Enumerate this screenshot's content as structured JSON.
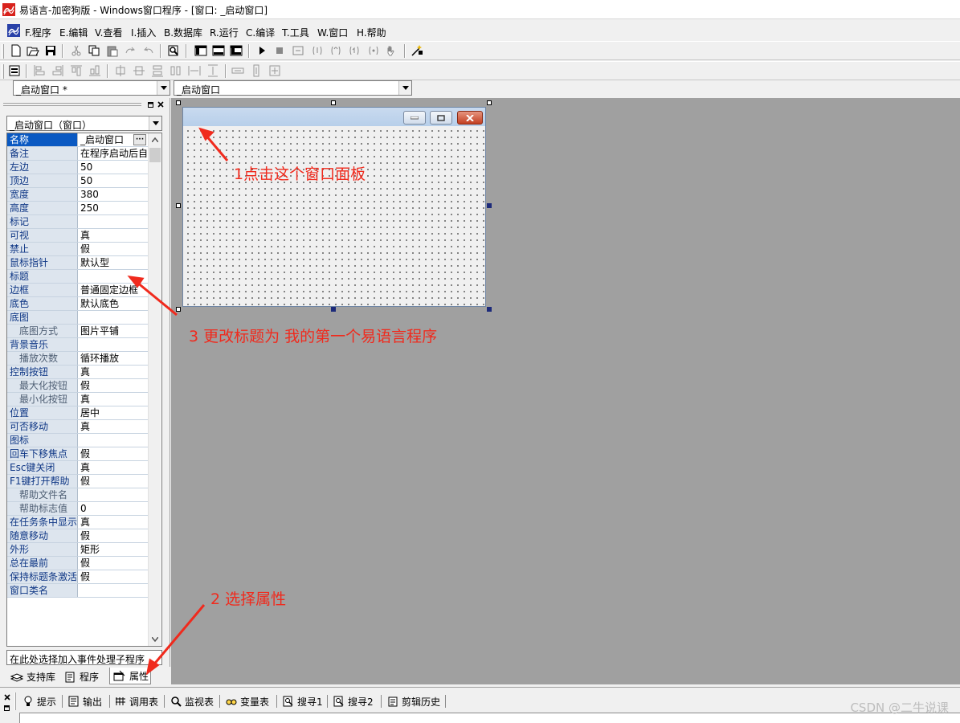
{
  "window_title": "易语言-加密狗版 - Windows窗口程序 - [窗口: _启动窗口]",
  "menu": [
    "F.程序",
    "E.编辑",
    "V.查看",
    "I.插入",
    "B.数据库",
    "R.运行",
    "C.编译",
    "T.工具",
    "W.窗口",
    "H.帮助"
  ],
  "combos": {
    "object_selector": "_启动窗口 *",
    "event_selector": "_启动窗口"
  },
  "panel": {
    "object_combo": "_启动窗口（窗口）",
    "properties": [
      {
        "name": "名称",
        "value": "_启动窗口"
      },
      {
        "name": "备注",
        "value": "在程序启动后自"
      },
      {
        "name": "左边",
        "value": "50"
      },
      {
        "name": "顶边",
        "value": "50"
      },
      {
        "name": "宽度",
        "value": "380"
      },
      {
        "name": "高度",
        "value": "250"
      },
      {
        "name": "标记",
        "value": ""
      },
      {
        "name": "可视",
        "value": "真"
      },
      {
        "name": "禁止",
        "value": "假"
      },
      {
        "name": "鼠标指针",
        "value": "默认型"
      },
      {
        "name": "标题",
        "value": ""
      },
      {
        "name": "边框",
        "value": "普通固定边框"
      },
      {
        "name": "底色",
        "value": "默认底色"
      },
      {
        "name": "底图",
        "value": ""
      },
      {
        "name": "底图方式",
        "value": "图片平铺"
      },
      {
        "name": "背景音乐",
        "value": ""
      },
      {
        "name": "播放次数",
        "value": "循环播放"
      },
      {
        "name": "控制按钮",
        "value": "真"
      },
      {
        "name": "最大化按钮",
        "value": "假"
      },
      {
        "name": "最小化按钮",
        "value": "真"
      },
      {
        "name": "位置",
        "value": "居中"
      },
      {
        "name": "可否移动",
        "value": "真"
      },
      {
        "name": "图标",
        "value": ""
      },
      {
        "name": "回车下移焦点",
        "value": "假"
      },
      {
        "name": "Esc键关闭",
        "value": "真"
      },
      {
        "name": "F1键打开帮助",
        "value": "假"
      },
      {
        "name": "帮助文件名",
        "value": ""
      },
      {
        "name": "帮助标志值",
        "value": "0"
      },
      {
        "name": "在任务条中显示",
        "value": "真"
      },
      {
        "name": "随意移动",
        "value": "假"
      },
      {
        "name": "外形",
        "value": "矩形"
      },
      {
        "name": "总在最前",
        "value": "假"
      },
      {
        "name": "保持标题条激活",
        "value": "假"
      },
      {
        "name": "窗口类名",
        "value": ""
      }
    ],
    "event_combo": "在此处选择加入事件处理子程序",
    "tabs": [
      "支持库",
      "程序",
      "属性"
    ]
  },
  "annotations": {
    "step1": "1点击这个窗口面板",
    "step2": "2 选择属性",
    "step3": "3 更改标题为  我的第一个易语言程序"
  },
  "bottom_tabs": [
    "提示",
    "输出",
    "调用表",
    "监视表",
    "变量表",
    "搜寻1",
    "搜寻2",
    "剪辑历史"
  ],
  "watermark": "CSDN @二牛说课",
  "colors": {
    "annotation": "#f02a1d",
    "selection": "#0a59c2",
    "workspace": "#a0a0a0"
  }
}
